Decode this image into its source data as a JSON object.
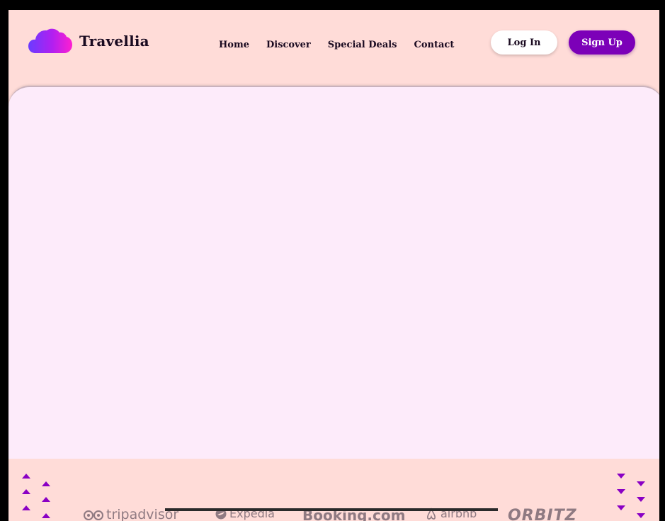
{
  "header": {
    "brand": "Travellia",
    "logo_icon": "cloud-icon",
    "nav": [
      "Home",
      "Discover",
      "Special Deals",
      "Contact"
    ],
    "login_label": "Log In",
    "signup_label": "Sign Up"
  },
  "partners": {
    "tripadvisor": "tripadvisor",
    "expedia": "Expedia",
    "booking": "Booking.com",
    "airbnb": "airbnb",
    "orbitz": "ORBITZ"
  },
  "colors": {
    "page_bg": "#ffdcd8",
    "hero_bg": "#fdebfa",
    "accent": "#7c00b8",
    "logo_gradient_start": "#7b3cff",
    "logo_gradient_end": "#ff1fd0"
  }
}
